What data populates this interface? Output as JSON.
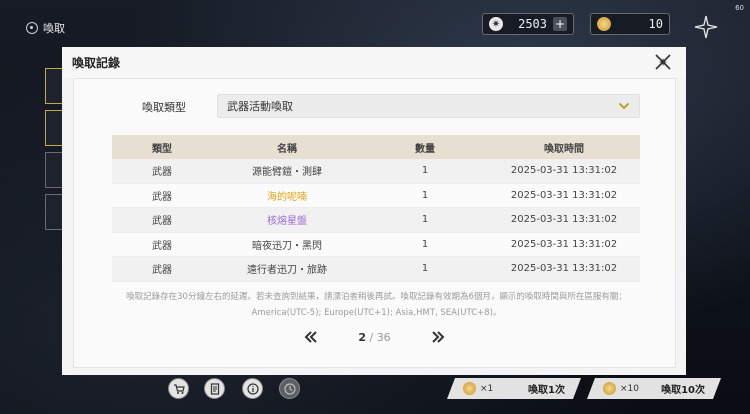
{
  "topbar": {
    "back_label": "喚取",
    "fps": "60",
    "currency1": {
      "value": "2503",
      "plus": "+",
      "icon": "✷"
    },
    "currency2": {
      "value": "10"
    }
  },
  "modal": {
    "title": "喚取記錄",
    "type_label": "喚取類型",
    "type_selected": "武器活動喚取",
    "table": {
      "headers": [
        "類型",
        "名稱",
        "數量",
        "喚取時間"
      ],
      "rows": [
        {
          "type": "武器",
          "name": "源能臂鎧・測肆",
          "qty": "1",
          "time": "2025-03-31 13:31:02",
          "rarity": "normal"
        },
        {
          "type": "武器",
          "name": "海的呢喃",
          "qty": "1",
          "time": "2025-03-31 13:31:02",
          "rarity": "gold"
        },
        {
          "type": "武器",
          "name": "核熔星盤",
          "qty": "1",
          "time": "2025-03-31 13:31:02",
          "rarity": "purple"
        },
        {
          "type": "武器",
          "name": "暗夜迅刀・黑閃",
          "qty": "1",
          "time": "2025-03-31 13:31:02",
          "rarity": "normal"
        },
        {
          "type": "武器",
          "name": "遠行者迅刀・旅跡",
          "qty": "1",
          "time": "2025-03-31 13:31:02",
          "rarity": "normal"
        }
      ]
    },
    "note_line1": "喚取記錄存在30分鐘左右的延遲。若未查詢到結果，請漂泊者稍後再試。喚取記錄有效期為6個月，顯示的喚取時間與所在區服有關：",
    "note_line2": "America(UTC-5); Europe(UTC+1); Asia,HMT, SEA(UTC+8)。",
    "pager": {
      "current": "2",
      "separator": "/",
      "total": "36"
    }
  },
  "bottom": {
    "summon1": {
      "mult": "×1",
      "label": "喚取1次"
    },
    "summon10": {
      "mult": "×10",
      "label": "喚取10次"
    }
  },
  "colors": {
    "gold": "#e0a50f",
    "purple": "#9a6bcf",
    "header_bg": "#e7dfd2"
  }
}
